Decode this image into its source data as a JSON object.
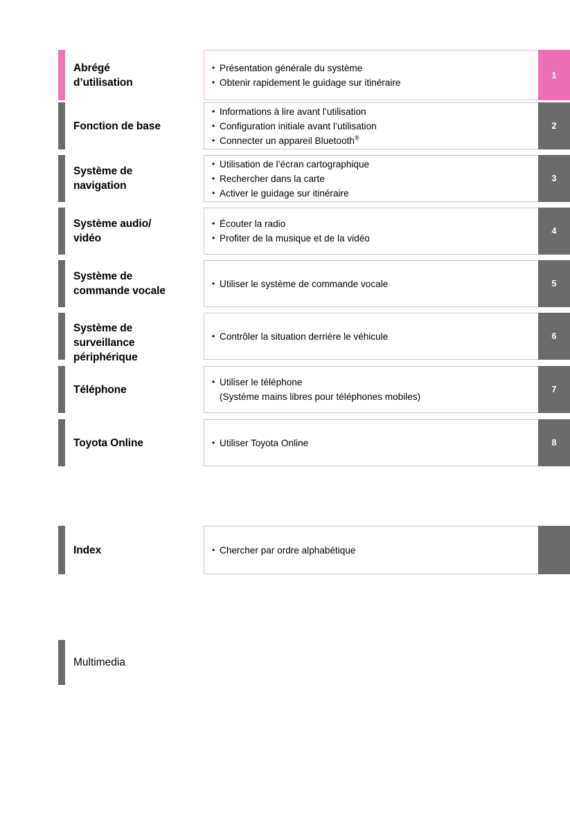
{
  "colors": {
    "accent_pink": "#ef6fb5",
    "accent_pink_light": "#f472b6",
    "tab_gray": "#6b6b6b",
    "border_gray": "#c9c9c9",
    "border_pink": "#f4b8d8"
  },
  "chapters": [
    {
      "title": "Abrégé\nd’utilisation",
      "title_line1": "Abrégé",
      "title_line2": "d’utilisation",
      "tab_number": "1",
      "accent": true,
      "bullets": [
        "Présentation générale du système",
        "Obtenir rapidement le guidage sur itinéraire"
      ]
    },
    {
      "title_line1": "Fonction de base",
      "title_line2": "",
      "tab_number": "2",
      "accent": false,
      "bullets": [
        "Informations à lire avant l’utilisation",
        "Configuration initiale avant l’utilisation",
        "Connecter un appareil Bluetooth®"
      ]
    },
    {
      "title_line1": "Système de",
      "title_line2": "navigation",
      "tab_number": "3",
      "accent": false,
      "bullets": [
        "Utilisation de l’écran cartographique",
        "Rechercher dans la carte",
        "Activer le guidage sur itinéraire"
      ]
    },
    {
      "title_line1": "Système audio/",
      "title_line2": "vidéo",
      "tab_number": "4",
      "accent": false,
      "bullets": [
        "Écouter la radio",
        "Profiter de la musique et de la vidéo"
      ]
    },
    {
      "title_line1": "Système de",
      "title_line2": "commande vocale",
      "tab_number": "5",
      "accent": false,
      "bullets": [
        "Utiliser le système de commande vocale"
      ]
    },
    {
      "title_line1": "Système de",
      "title_line2": "surveillance",
      "title_line3": "périphérique",
      "tab_number": "6",
      "accent": false,
      "bullets": [
        "Contrôler la situation derrière le véhicule"
      ]
    },
    {
      "title_line1": "Téléphone",
      "title_line2": "",
      "tab_number": "7",
      "accent": false,
      "bullets": [
        "Utiliser le téléphone",
        "(Système mains libres pour téléphones mobiles)"
      ]
    },
    {
      "title_line1": "Toyota Online",
      "title_line2": "",
      "tab_number": "8",
      "accent": false,
      "bullets": [
        "Utiliser Toyota Online"
      ]
    }
  ],
  "index_section": {
    "title": "Index",
    "tab_number": "",
    "bullets": [
      "Chercher par ordre alphabétique"
    ]
  },
  "multimedia_section": {
    "title": "Multimedia"
  }
}
